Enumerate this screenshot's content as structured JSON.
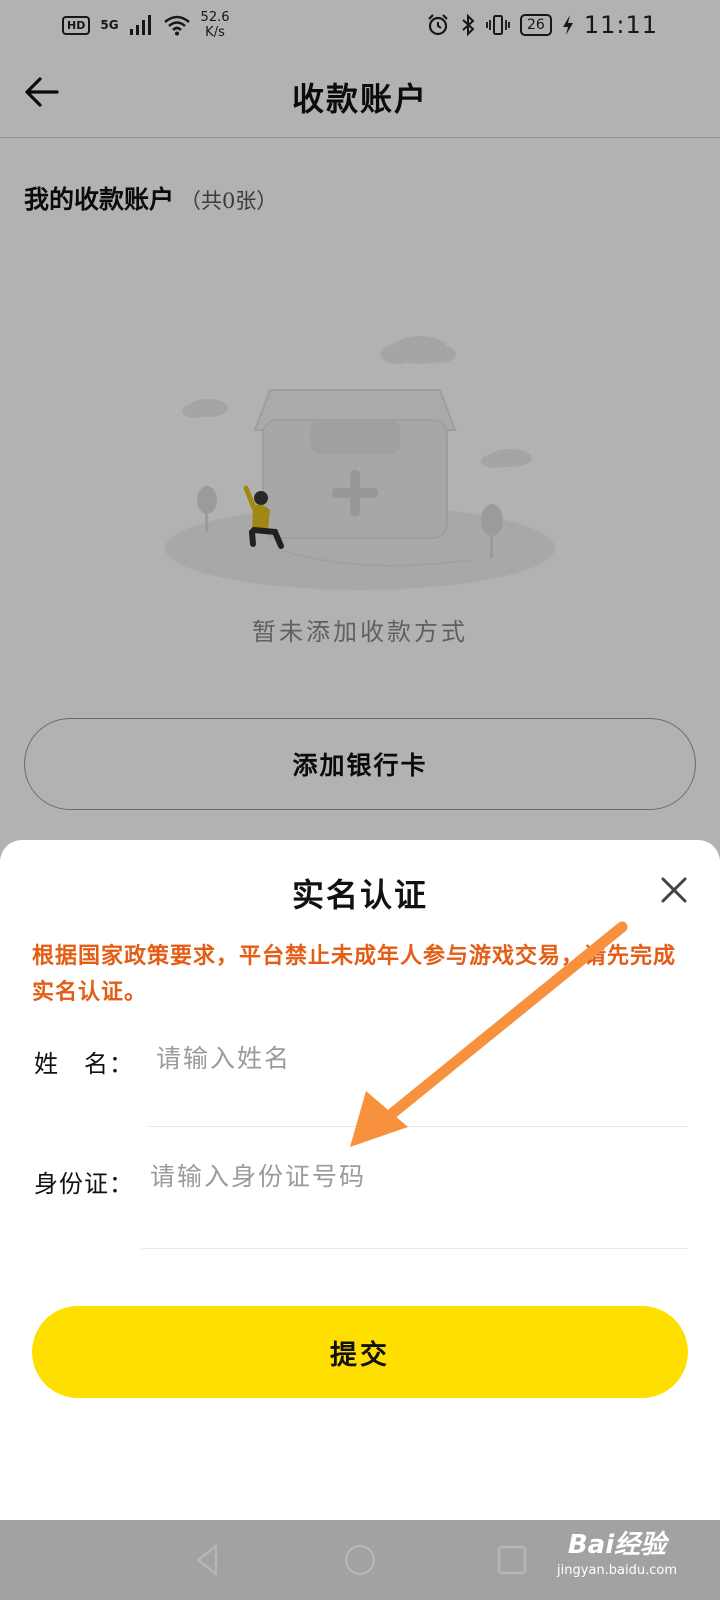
{
  "status_bar": {
    "hd": "HD",
    "network": "5G",
    "net_speed": "52.6",
    "net_speed_unit": "K/s",
    "battery": "26",
    "time": "11:11"
  },
  "app_bar": {
    "back_icon": "arrow-left-icon",
    "title": "收款账户"
  },
  "accounts": {
    "section_title": "我的收款账户",
    "count_text": "（共0张）",
    "empty_text": "暂未添加收款方式",
    "add_button": "添加银行卡"
  },
  "modal": {
    "title": "实名认证",
    "close_icon": "close-icon",
    "notice": "根据国家政策要求，平台禁止未成年人参与游戏交易，请先完成实名认证。",
    "name_label": "姓　名：",
    "name_placeholder": "请输入姓名",
    "id_label": "身份证：",
    "id_placeholder": "请输入身份证号码",
    "submit_label": "提交"
  },
  "watermark": {
    "brand": "Bai经验",
    "domain": "jingyan.baidu.com"
  },
  "colors": {
    "accent_yellow": "#ffdf00",
    "notice_orange": "#e35d14",
    "arrow_orange": "#f7913d"
  }
}
